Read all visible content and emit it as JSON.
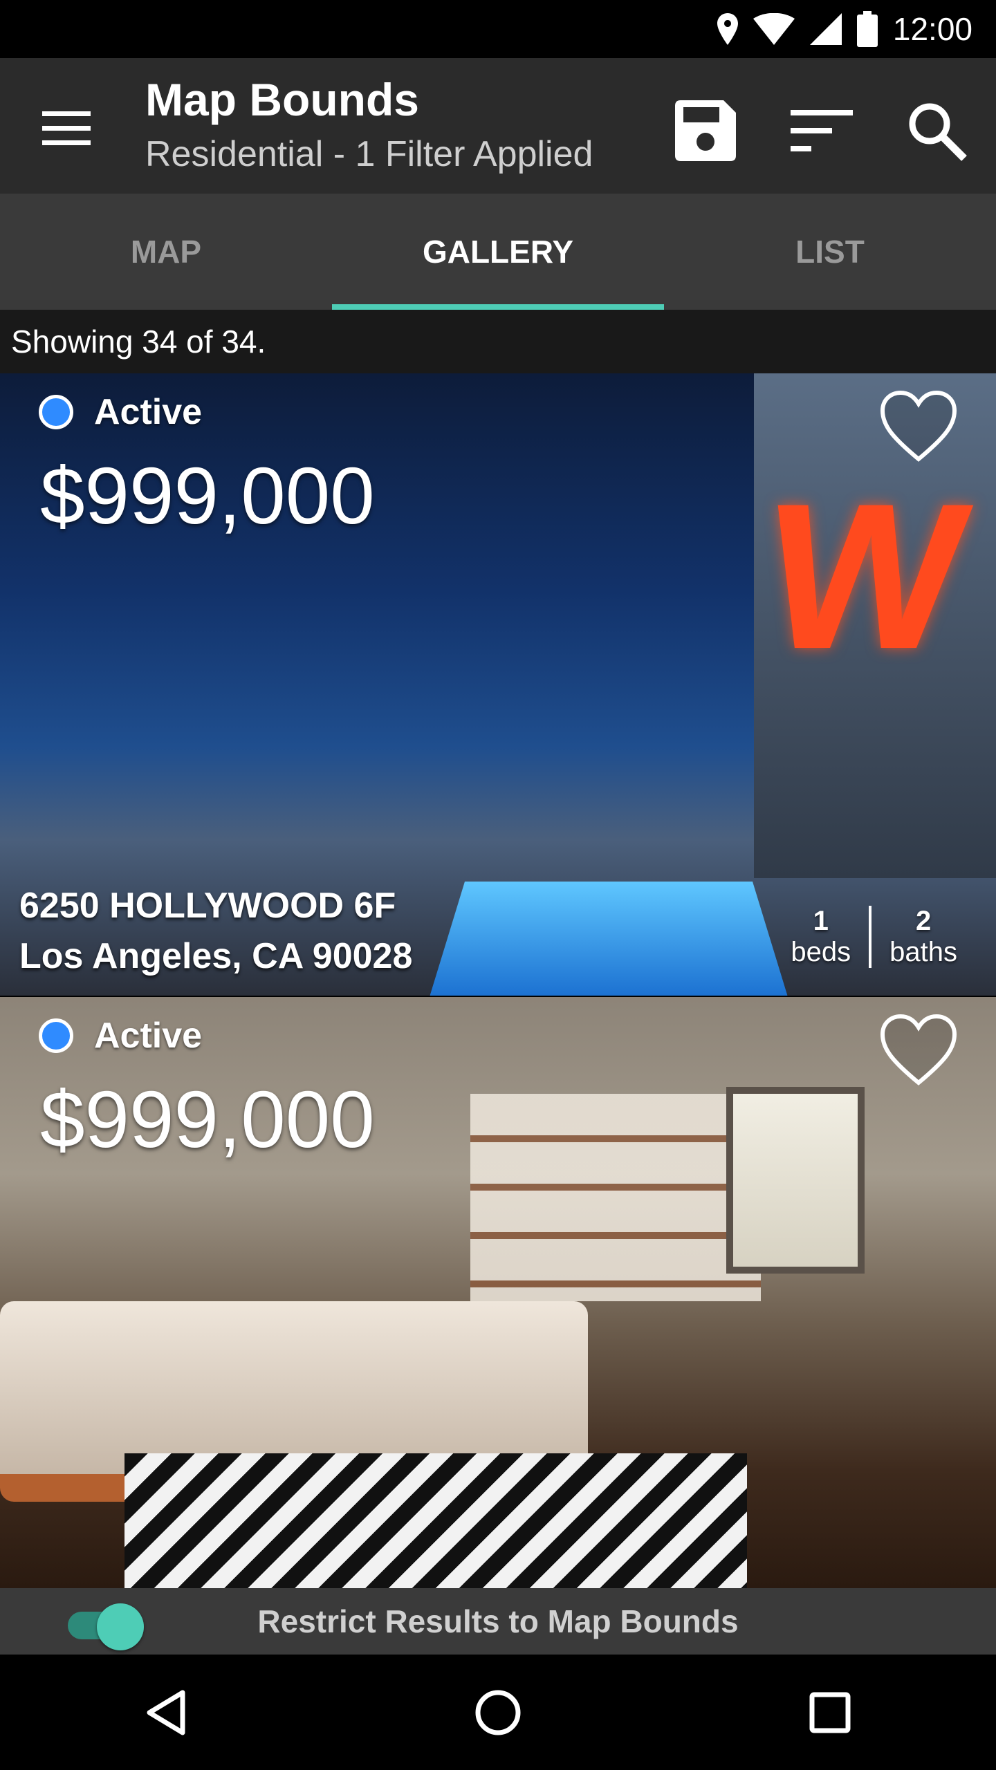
{
  "status_bar": {
    "time": "12:00"
  },
  "app_bar": {
    "title": "Map Bounds",
    "subtitle": "Residential - 1 Filter Applied"
  },
  "tabs": [
    {
      "label": "MAP"
    },
    {
      "label": "GALLERY",
      "selected": true
    },
    {
      "label": "LIST"
    }
  ],
  "results": {
    "summary": "Showing 34 of 34."
  },
  "listings": [
    {
      "status": "Active",
      "price": "$999,000",
      "address_line1": "6250 HOLLYWOOD 6F",
      "address_line2": "Los Angeles, CA 90028",
      "beds": "1",
      "beds_label": "beds",
      "baths": "2",
      "baths_label": "baths"
    },
    {
      "status": "Active",
      "price": "$999,000"
    }
  ],
  "map_bounds": {
    "label": "Restrict Results to Map Bounds",
    "enabled": true
  },
  "colors": {
    "accent": "#4ecdb6",
    "status_active": "#2f8bff",
    "toolbar": "#2b2b2b",
    "tabs_bg": "#3a3a3a"
  },
  "icons": [
    "menu-icon",
    "save-icon",
    "sort-icon",
    "search-icon",
    "heart-outline-icon",
    "back-icon",
    "home-icon",
    "recents-icon",
    "location-icon",
    "wifi-icon",
    "signal-icon",
    "battery-icon"
  ]
}
